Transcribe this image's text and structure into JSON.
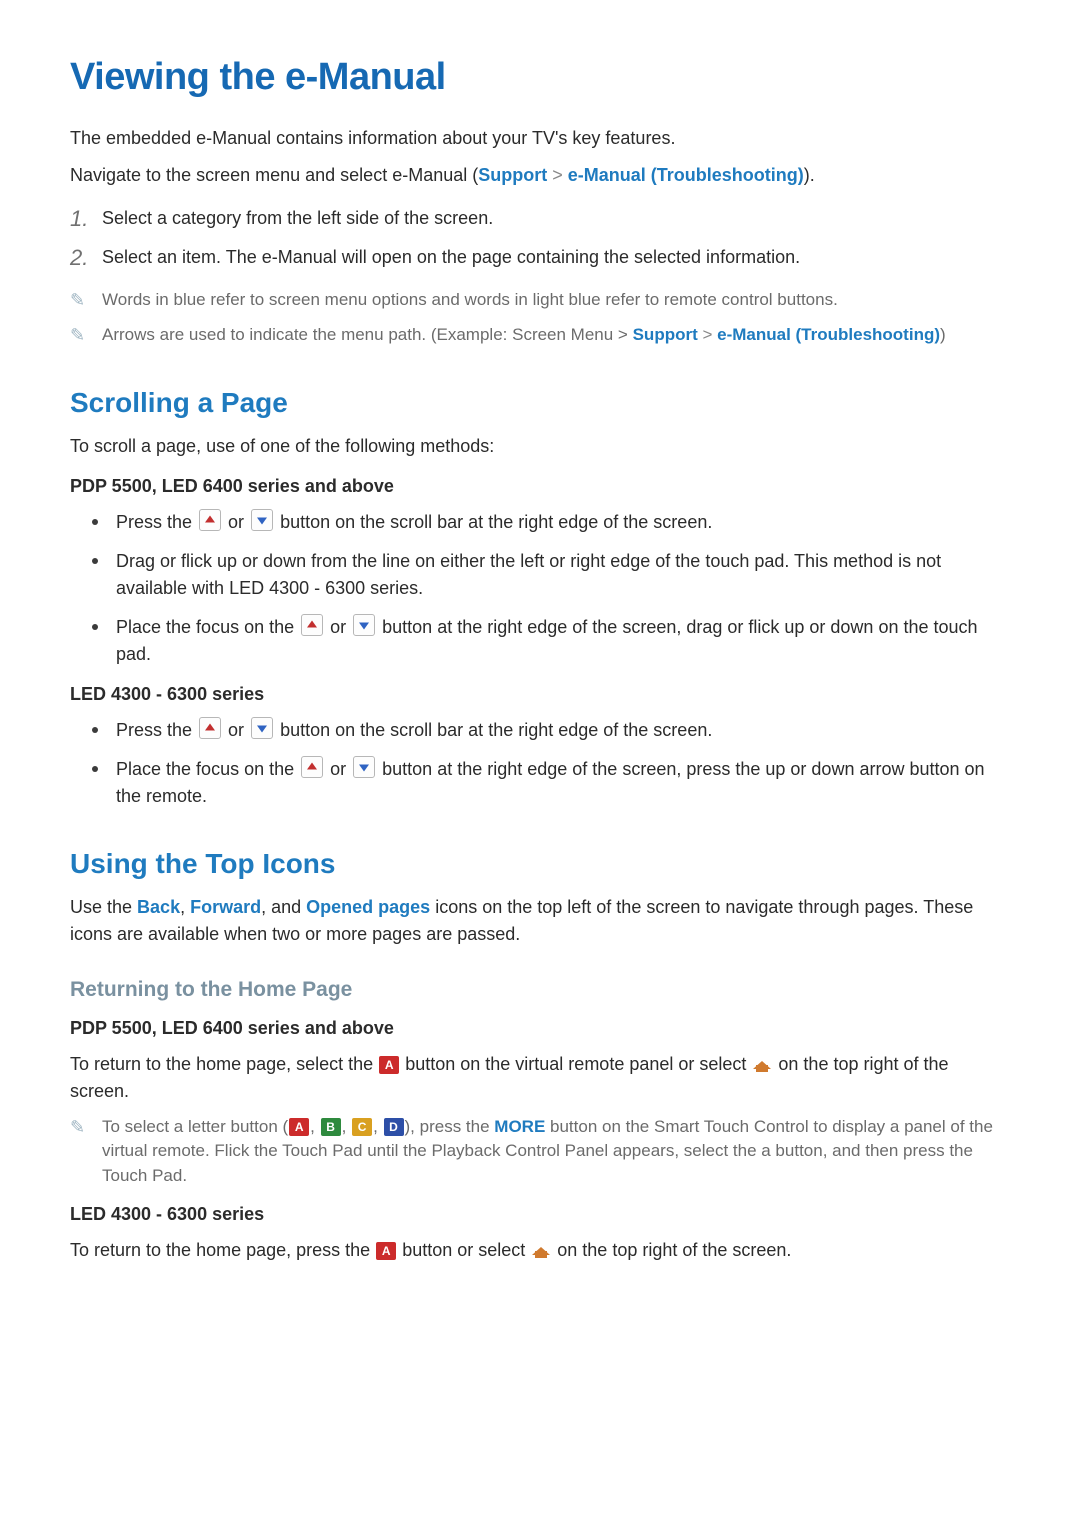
{
  "title": "Viewing the e-Manual",
  "intro": {
    "line1": "The embedded e-Manual contains information about your TV's key features.",
    "line2a": "Navigate to the screen menu and select e-Manual (",
    "line2_support": "Support",
    "line2_sep": " > ",
    "line2_link": "e-Manual (Troubleshooting)",
    "line2b": ")."
  },
  "steps": [
    {
      "marker": "1.",
      "text": "Select a category from the left side of the screen."
    },
    {
      "marker": "2.",
      "text": "Select an item. The e-Manual will open on the page containing the selected information."
    }
  ],
  "notes1": {
    "n1": "Words in blue refer to screen menu options and words in light blue refer to remote control buttons.",
    "n2a": "Arrows are used to indicate the menu path. (Example: Screen Menu > ",
    "n2_support": "Support",
    "n2_sep": " > ",
    "n2_link": "e-Manual (Troubleshooting)",
    "n2b": ")"
  },
  "scroll": {
    "heading": "Scrolling a Page",
    "intro": "To scroll a page, use of one of the following methods:",
    "series1": "PDP 5500, LED 6400 series and above",
    "s1b1a": "Press the ",
    "s1b1b": " or ",
    "s1b1c": " button on the scroll bar at the right edge of the screen.",
    "s1b2": "Drag or flick up or down from the line on either the left or right edge of the touch pad. This method is not available with LED 4300 - 6300 series.",
    "s1b3a": "Place the focus on the ",
    "s1b3b": " or ",
    "s1b3c": " button at the right edge of the screen, drag or flick up or down on the touch pad.",
    "series2": "LED 4300 - 6300 series",
    "s2b1a": "Press the ",
    "s2b1b": " or ",
    "s2b1c": " button on the scroll bar at the right edge of the screen.",
    "s2b2a": "Place the focus on the ",
    "s2b2b": " or ",
    "s2b2c": " button at the right edge of the screen, press the up or down arrow button on the remote."
  },
  "topicons": {
    "heading": "Using the Top Icons",
    "p1a": "Use the ",
    "back": "Back",
    "c1": ", ",
    "forward": "Forward",
    "c2": ", and ",
    "opened": "Opened pages",
    "p1b": " icons on the top left of the screen to navigate through pages. These icons are available when two or more pages are passed."
  },
  "home": {
    "heading": "Returning to the Home Page",
    "series1": "PDP 5500, LED 6400 series and above",
    "p1a": "To return to the home page, select the ",
    "p1b": " button on the virtual remote panel or select ",
    "p1c": " on the top right of the screen.",
    "note_a": "To select a letter button (",
    "note_b": ", ",
    "note_c": "), press the ",
    "more": "MORE",
    "note_d": " button on the Smart Touch Control to display a panel of the virtual remote. Flick the Touch Pad until the Playback Control Panel appears, select the a button, and then press the Touch Pad.",
    "series2": "LED 4300 - 6300 series",
    "p2a": "To return to the home page, press the ",
    "p2b": " button or select ",
    "p2c": " on the top right of the screen."
  },
  "letters": {
    "a": "A",
    "b": "B",
    "c": "C",
    "d": "D"
  }
}
